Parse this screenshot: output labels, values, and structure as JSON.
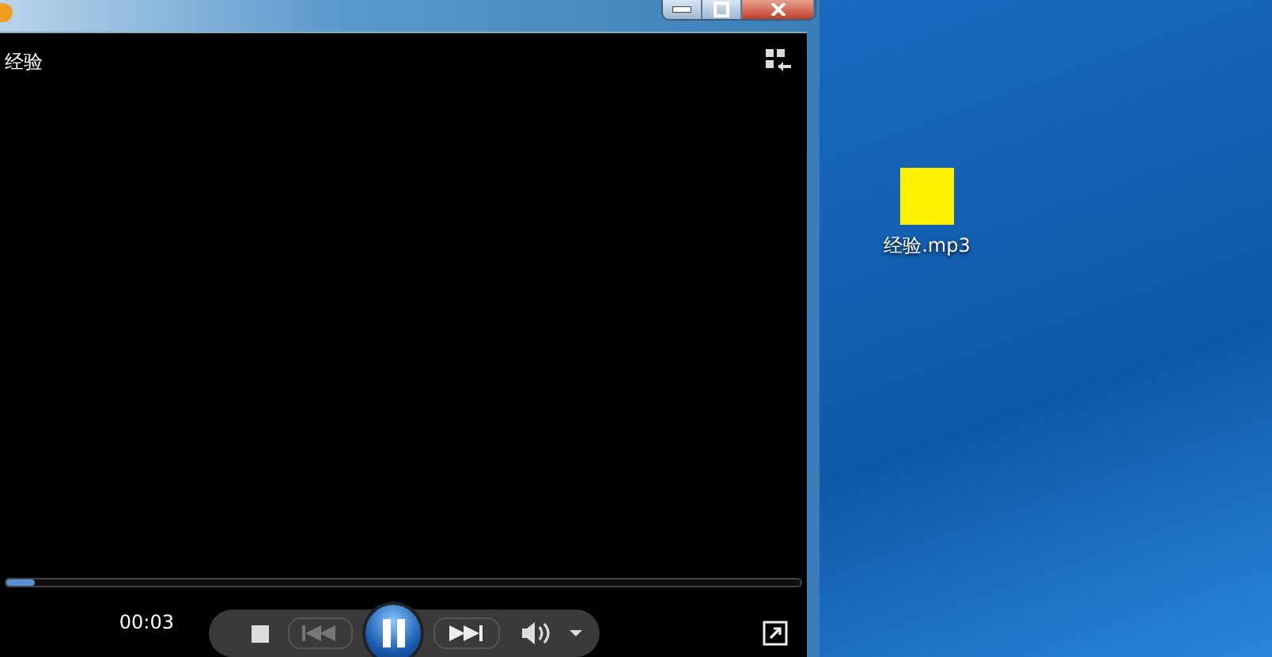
{
  "player": {
    "now_playing": "经验",
    "elapsed": "00:03",
    "progress": {
      "level": 0.035
    },
    "playing": true
  },
  "desktop": {
    "icons": [
      {
        "label": "经验.mp3"
      }
    ]
  }
}
